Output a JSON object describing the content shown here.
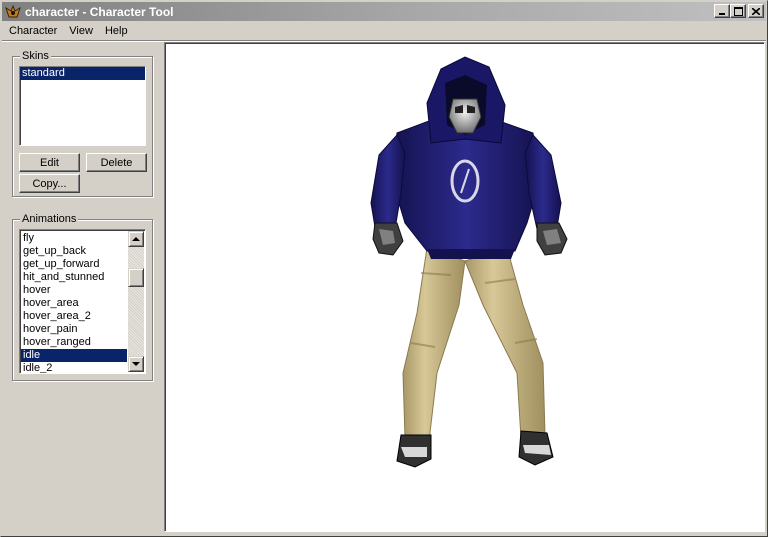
{
  "window": {
    "title": "character - Character Tool",
    "minimize_glyph": "_",
    "maximize_glyph": "□",
    "close_glyph": "✕"
  },
  "menu": {
    "items": [
      "Character",
      "View",
      "Help"
    ]
  },
  "skins": {
    "label": "Skins",
    "items": [
      {
        "label": "standard",
        "selected": true
      }
    ],
    "edit_label": "Edit",
    "delete_label": "Delete",
    "copy_label": "Copy..."
  },
  "animations": {
    "label": "Animations",
    "items": [
      {
        "label": "fly",
        "selected": false
      },
      {
        "label": "get_up_back",
        "selected": false
      },
      {
        "label": "get_up_forward",
        "selected": false
      },
      {
        "label": "hit_and_stunned",
        "selected": false
      },
      {
        "label": "hover",
        "selected": false
      },
      {
        "label": "hover_area",
        "selected": false
      },
      {
        "label": "hover_area_2",
        "selected": false
      },
      {
        "label": "hover_pain",
        "selected": false
      },
      {
        "label": "hover_ranged",
        "selected": false
      },
      {
        "label": "idle",
        "selected": true
      },
      {
        "label": "idle_2",
        "selected": false
      }
    ]
  },
  "viewport": {
    "model": "character-3d-model",
    "background": "#ffffff",
    "colors": {
      "hoodie": "#1e1c78",
      "pants": "#c8b888",
      "mask": "#c8c8c8"
    }
  },
  "colors": {
    "selection": "#0a246a",
    "face": "#d4d0c8"
  }
}
